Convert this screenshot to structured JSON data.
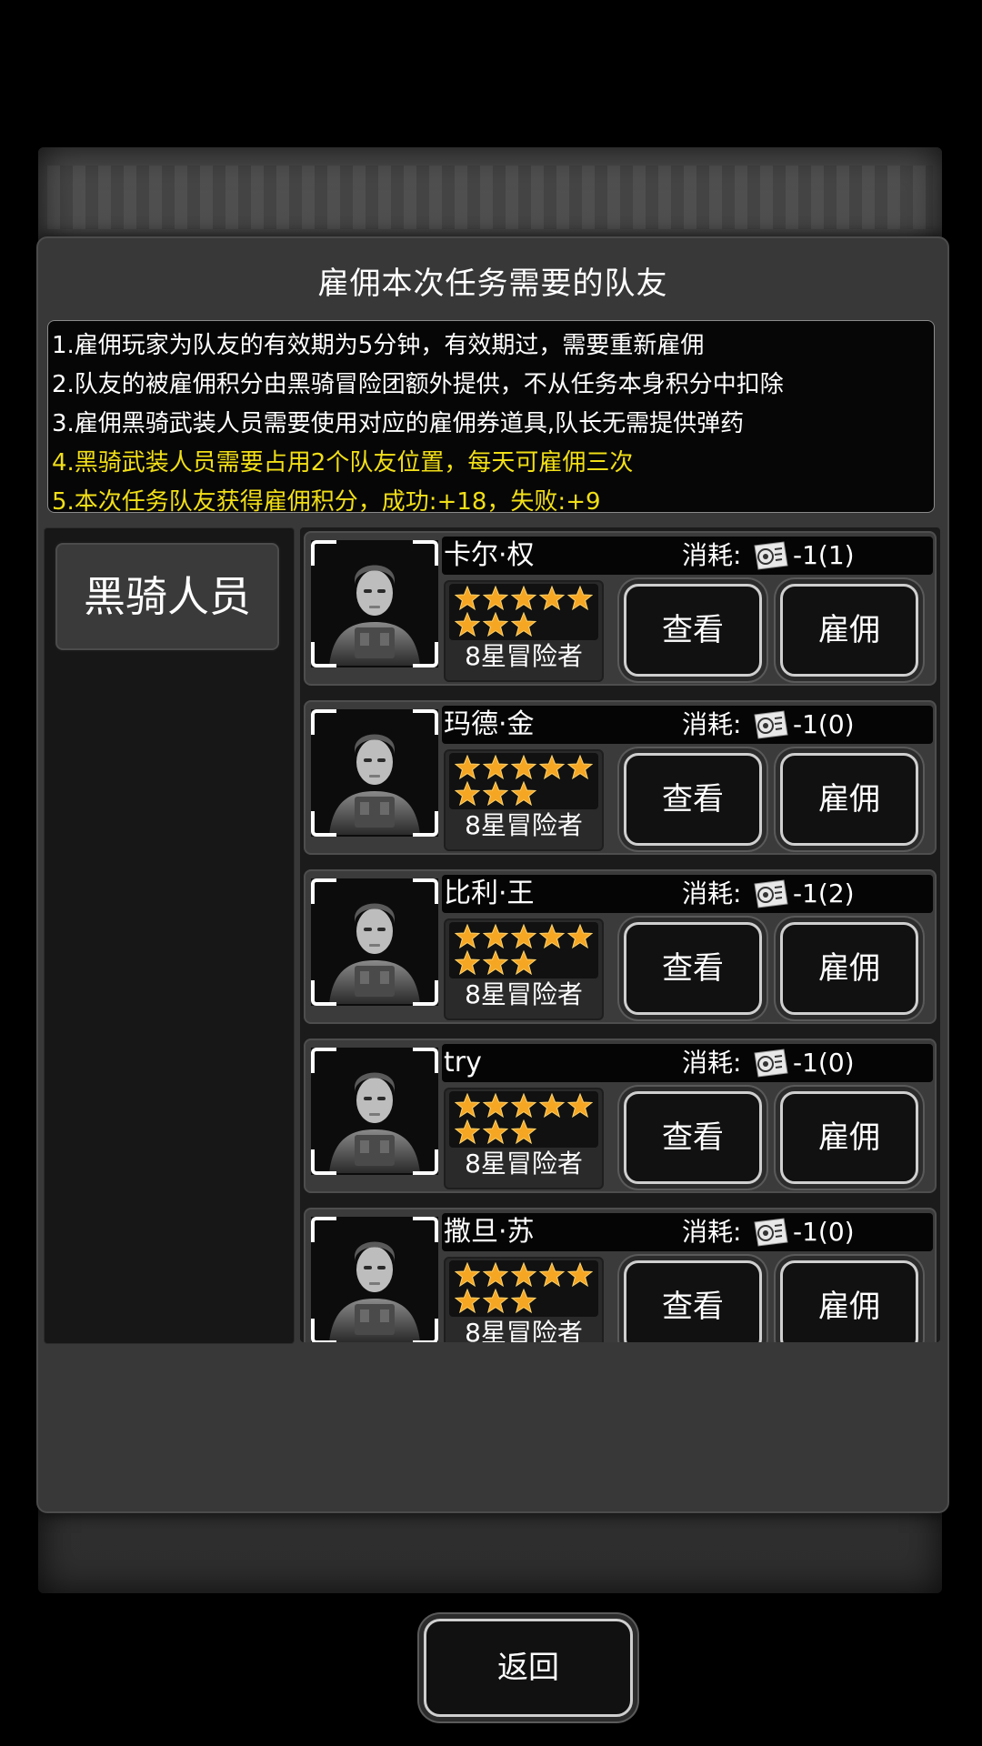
{
  "dialog": {
    "title": "雇佣本次任务需要的队友",
    "rules": [
      "1.雇佣玩家为队友的有效期为5分钟，有效期过，需要重新雇佣",
      "2.队友的被雇佣积分由黑骑冒险团额外提供，不从任务本身积分中扣除",
      "3.雇佣黑骑武装人员需要使用对应的雇佣券道具,队长无需提供弹药",
      "4.黑骑武装人员需要占用2个队友位置，每天可雇佣三次",
      "5.本次任务队友获得雇佣积分，成功:+18，失败:+9"
    ],
    "highlight_color": "#f2df17"
  },
  "sidebar": {
    "tab_label": "黑骑人员"
  },
  "cost_label": "消耗:",
  "view_label": "查看",
  "hire_label": "雇佣",
  "back_label": "返回",
  "icons": {
    "ticket": "hire-ticket-icon",
    "star": "star-icon",
    "portrait": "soldier-portrait"
  },
  "mercenaries": [
    {
      "name": "卡尔·权",
      "cost": "-1(1)",
      "stars": 8,
      "rank": "8星冒险者"
    },
    {
      "name": "玛德·金",
      "cost": "-1(0)",
      "stars": 8,
      "rank": "8星冒险者"
    },
    {
      "name": "比利·王",
      "cost": "-1(2)",
      "stars": 8,
      "rank": "8星冒险者"
    },
    {
      "name": "try",
      "cost": "-1(0)",
      "stars": 8,
      "rank": "8星冒险者"
    },
    {
      "name": "撒旦·苏",
      "cost": "-1(0)",
      "stars": 8,
      "rank": "8星冒险者"
    }
  ]
}
